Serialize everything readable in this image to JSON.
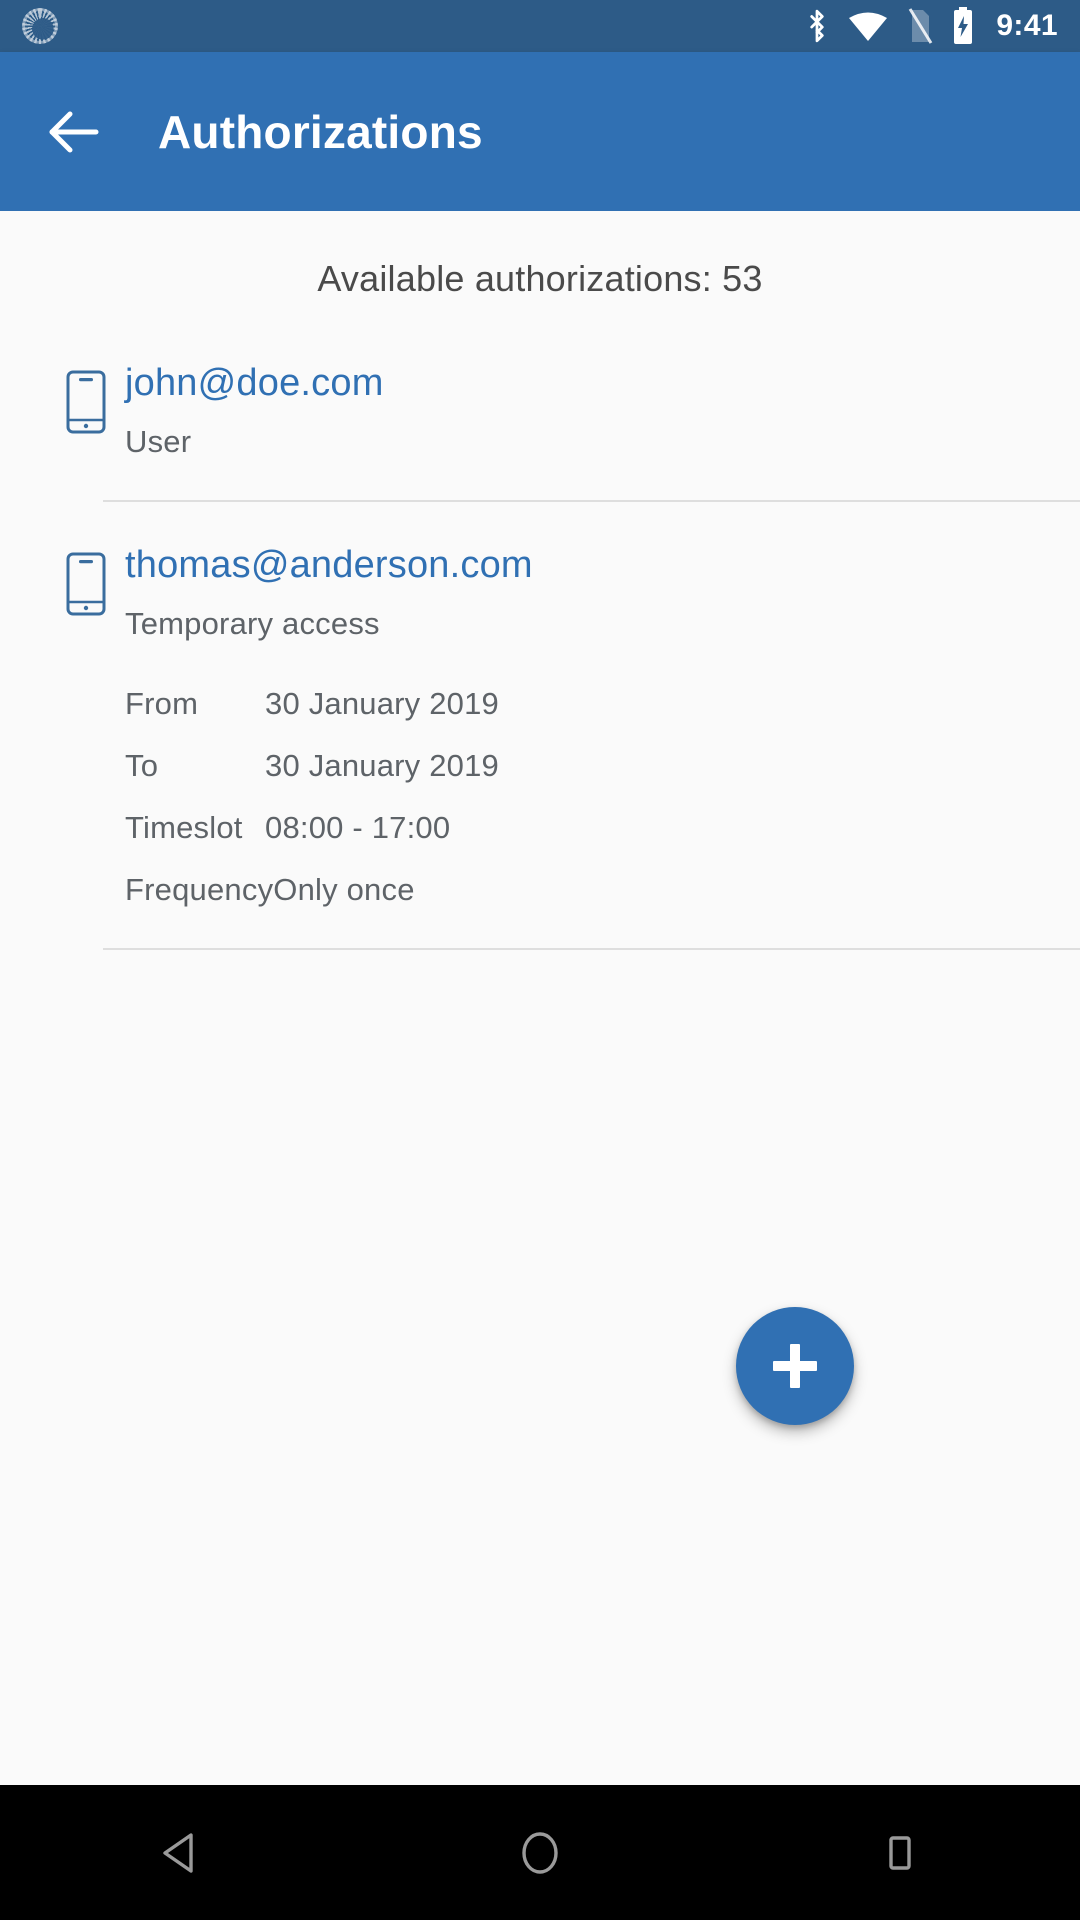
{
  "status_bar": {
    "time": "9:41",
    "left_icons": [
      {
        "name": "sync-icon"
      }
    ],
    "right_icons": [
      {
        "name": "bluetooth-icon"
      },
      {
        "name": "wifi-icon"
      },
      {
        "name": "no-sim-icon"
      },
      {
        "name": "battery-charging-icon"
      }
    ],
    "background_color": "#2d5b87"
  },
  "app_bar": {
    "back_label": "back-arrow",
    "title": "Authorizations",
    "background_color": "#3070b3"
  },
  "content": {
    "available_text": "Available authorizations: 53",
    "accent_color": "#3070b3",
    "text_color": "#5e6368",
    "background_color": "#fafafa"
  },
  "authorizations": [
    {
      "icon": "smartphone-icon",
      "email": "john@doe.com",
      "subtitle": "User",
      "details": []
    },
    {
      "icon": "smartphone-icon",
      "email": "thomas@anderson.com",
      "subtitle": "Temporary access",
      "details": [
        {
          "label": "From",
          "value": "30 January 2019"
        },
        {
          "label": "To",
          "value": "30 January 2019"
        },
        {
          "label": "Timeslot",
          "value": "08:00 - 17:00"
        },
        {
          "label": "Frequency",
          "value": "Only once"
        }
      ]
    }
  ],
  "fab": {
    "icon": "plus-icon",
    "color": "#3070b3"
  },
  "nav_bar": {
    "buttons": [
      {
        "name": "nav-back-button"
      },
      {
        "name": "nav-home-button"
      },
      {
        "name": "nav-recents-button"
      }
    ],
    "background_color": "#000000"
  }
}
